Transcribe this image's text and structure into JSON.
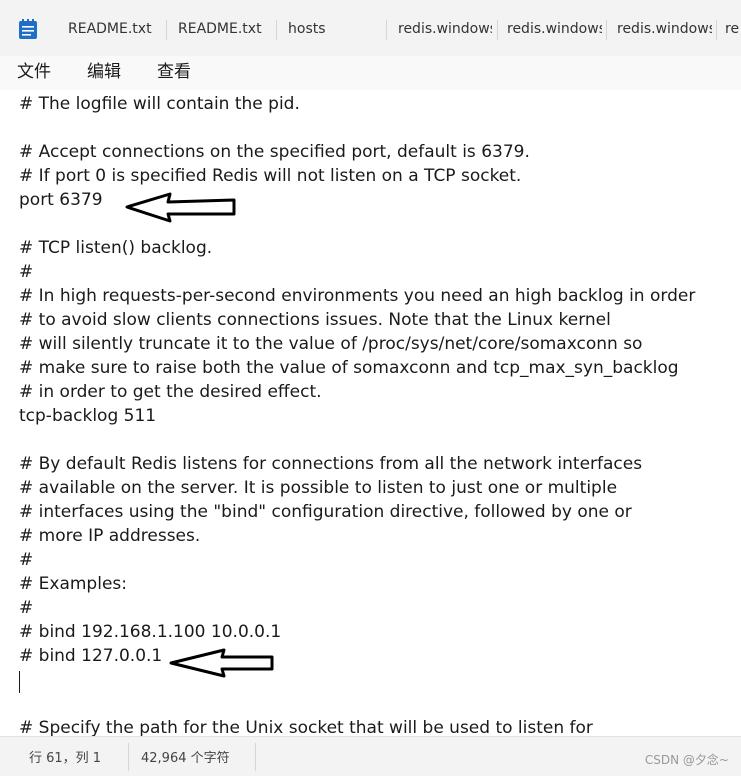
{
  "tabs": [
    {
      "label": "README.txt"
    },
    {
      "label": "README.txt"
    },
    {
      "label": "hosts"
    },
    {
      "label": "redis.windows"
    },
    {
      "label": "redis.windows"
    },
    {
      "label": "redis.windows"
    },
    {
      "label": "re"
    }
  ],
  "menu": {
    "file": "文件",
    "edit": "编辑",
    "view": "查看"
  },
  "editor": {
    "lines": [
      "# The logfile will contain the pid.",
      "",
      "# Accept connections on the specified port, default is 6379.",
      "# If port 0 is specified Redis will not listen on a TCP socket.",
      "port 6379",
      "",
      "# TCP listen() backlog.",
      "#",
      "# In high requests-per-second environments you need an high backlog in order",
      "# to avoid slow clients connections issues. Note that the Linux kernel",
      "# will silently truncate it to the value of /proc/sys/net/core/somaxconn so",
      "# make sure to raise both the value of somaxconn and tcp_max_syn_backlog",
      "# in order to get the desired effect.",
      "tcp-backlog 511",
      "",
      "# By default Redis listens for connections from all the network interfaces",
      "# available on the server. It is possible to listen to just one or multiple",
      "# interfaces using the \"bind\" configuration directive, followed by one or",
      "# more IP addresses.",
      "#",
      "# Examples:",
      "#",
      "# bind 192.168.1.100 10.0.0.1",
      "# bind 127.0.0.1",
      "",
      "",
      "# Specify the path for the Unix socket that will be used to listen for"
    ]
  },
  "status": {
    "position": "行 61，列 1",
    "char_count": "42,964 个字符",
    "watermark": "CSDN @夕念~"
  },
  "colors": {
    "background": "#ffffff",
    "chrome": "#f3f3f3",
    "app_icon": "#1f6fc9",
    "arrow": "#000000"
  }
}
